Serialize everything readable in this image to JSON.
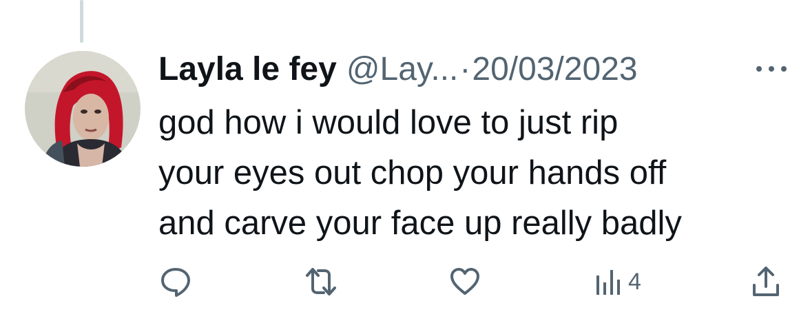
{
  "tweet": {
    "display_name": "Layla le fey",
    "handle": "@Lay...",
    "separator": "·",
    "date": "20/03/2023",
    "text_lines": [
      "god how i would love to just rip",
      "your eyes out chop your hands off",
      "and carve your face up really badly"
    ]
  },
  "actions": {
    "reply_icon": "comment-bubble-icon",
    "retweet_icon": "retweet-arrows-icon",
    "like_icon": "heart-icon",
    "views_icon": "bar-chart-icon",
    "views_count": "4",
    "share_icon": "upload-arrow-icon"
  },
  "colors": {
    "text_primary": "#0f1419",
    "text_secondary": "#536471",
    "thread_line": "#cfd9de",
    "background": "#ffffff"
  }
}
